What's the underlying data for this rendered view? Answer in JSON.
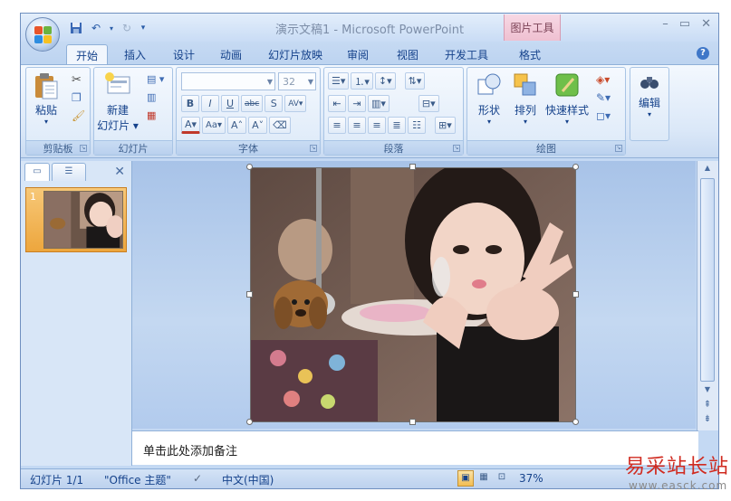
{
  "window": {
    "title": "演示文稿1 - Microsoft PowerPoint",
    "context_tab": "图片工具",
    "controls": [
      "–",
      "▭",
      "✕"
    ]
  },
  "tabs": [
    {
      "label": "开始",
      "active": true
    },
    {
      "label": "插入",
      "active": false
    },
    {
      "label": "设计",
      "active": false
    },
    {
      "label": "动画",
      "active": false
    },
    {
      "label": "幻灯片放映",
      "active": false
    },
    {
      "label": "审阅",
      "active": false
    },
    {
      "label": "视图",
      "active": false
    },
    {
      "label": "开发工具",
      "active": false
    },
    {
      "label": "格式",
      "active": false
    }
  ],
  "ribbon": {
    "clipboard": {
      "label": "剪贴板",
      "paste": "粘贴"
    },
    "slides": {
      "label": "幻灯片",
      "new_slide_line1": "新建",
      "new_slide_line2": "幻灯片 ▾"
    },
    "font": {
      "label": "字体",
      "font_name": "",
      "font_size": "32"
    },
    "paragraph": {
      "label": "段落"
    },
    "drawing": {
      "label": "绘图",
      "shapes": "形状",
      "arrange": "排列",
      "quick_styles": "快速样式"
    },
    "editing": {
      "label": "编辑"
    }
  },
  "slide_panel": {
    "slide_number": "1"
  },
  "notes": {
    "placeholder": "单击此处添加备注"
  },
  "status": {
    "slide": "幻灯片 1/1",
    "theme": "\"Office 主题\"",
    "language": "中文(中国)",
    "zoom": "37%"
  },
  "watermark": {
    "text": "易采站长站",
    "url": "www.easck.com"
  }
}
